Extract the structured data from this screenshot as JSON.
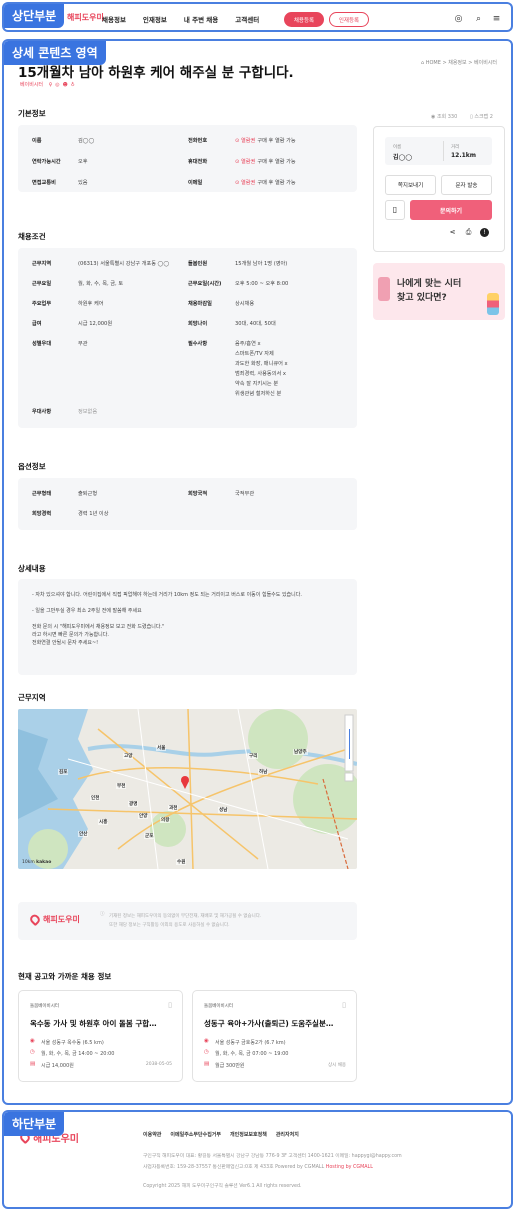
{
  "labels": {
    "top": "상단부분",
    "mid": "상세 콘텐츠 영역",
    "bot": "하단부분"
  },
  "header": {
    "logo": "해피도우미",
    "nav": [
      "채용정보",
      "인재정보",
      "내 주변 채용",
      "고객센터"
    ],
    "btn_job": "채용등록",
    "btn_talent": "인재등록"
  },
  "job": {
    "title": "15개월차 남아 하원후 케어 해주실 분 구합니다.",
    "category": "베이비시터",
    "breadcrumb": "HOME > 채용정보 > 베이비시터",
    "views": "조회 330",
    "scraps": "스크랩 2"
  },
  "basic": {
    "heading": "기본정보",
    "rows": [
      [
        "이름",
        "김◯◯",
        "전화번호",
        "열람권",
        "구매 후 열람 가능"
      ],
      [
        "연락가능시간",
        "오후",
        "휴대전화",
        "열람권",
        "구매 후 열람 가능"
      ],
      [
        "면접교통비",
        "있음",
        "이메일",
        "열람권",
        "구매 후 열람 가능"
      ]
    ]
  },
  "conditions": {
    "heading": "채용조건",
    "rows": [
      [
        "근무지역",
        "(06313) 서울특별시 강남구 개포동 ◯◯",
        "돌봄인원",
        "15개월 남아 1명 (영아)"
      ],
      [
        "근무요일",
        "월, 화, 수, 목, 금, 토",
        "근무요일(시간)",
        "오후 5:00 ~ 오후 8:00"
      ],
      [
        "주요업무",
        "하원후 케어",
        "채용마감일",
        "상시채용"
      ],
      [
        "급여",
        "시급 12,000원",
        "희망나이",
        "30대, 40대, 50대"
      ],
      [
        "성별우대",
        "무관",
        "필수사항",
        "음주/흡연 x"
      ]
    ],
    "required_extra": [
      "스마트폰/TV 자제",
      "과도한 화장, 매니큐어 x",
      "범죄경력, 사용동의서 x",
      "약속 잘 지키시는 분",
      "위생관념 철저하신 분"
    ],
    "pref_key": "우대사항",
    "pref_val": "정보없음"
  },
  "options": {
    "heading": "옵션정보",
    "rows": [
      [
        "근무형태",
        "출퇴근형",
        "희망국적",
        "국적무관"
      ],
      [
        "희망경력",
        "경력 1년 이상",
        "",
        ""
      ]
    ]
  },
  "detail": {
    "heading": "상세내용",
    "lines": [
      "- 자차 있으셔야 합니다. 어린이집에서 직접 픽업해야 하는데 거리가 10km 정도 되는 거리이고 버스로 이동이 힘들수도 있습니다.",
      "",
      "- 일을 그만두실 경우 최소 2주일 전에 말씀해 주세요",
      "",
      "전화 문의 시 \"해피도우미에서 채용정보 보고 전화 드렸습니다.\"",
      "라고 하시면 빠른 문의가 가능합니다.",
      "전화연결 안될시 문자 주세요~!"
    ]
  },
  "location": {
    "heading": "근무지역",
    "map_labels": [
      "서울",
      "인천",
      "부천",
      "광명",
      "과천",
      "안양",
      "성남",
      "하남",
      "구리",
      "안산",
      "시흥",
      "군포",
      "의왕",
      "수원",
      "고양",
      "김포",
      "남양주"
    ],
    "scale": "10km",
    "brand": "kakao"
  },
  "sidebar": {
    "name_label": "이름",
    "name": "김◯◯",
    "dist_label": "거리",
    "dist": "12.1km",
    "btn_msg": "쪽지보내기",
    "btn_sms": "문자 발송",
    "btn_inquiry": "문의하기",
    "banner_line1": "나에게 맞는 시터",
    "banner_line2": "찾고 있다면?"
  },
  "notice": {
    "logo": "해피도우미",
    "lines": [
      "기재된 정보는 해피도우미의 동의없이 무단전재, 재배포 및 재가공될 수 없습니다.",
      "또한 해당 정보는 구직활동 이외의 용도로 사용하실 수 없습니다."
    ]
  },
  "nearby": {
    "heading": "현재 공고와 가까운 채용 정보",
    "cards": [
      {
        "cat": "돌봄베이비시터",
        "title": "옥수동 가사 및 하원후 아이 돌봄 구합…",
        "loc": "서울 성동구 옥수동 (6.5 km)",
        "time": "월, 화, 수, 목, 금 14:00 ~ 20:00",
        "pay": "시급 14,000원",
        "extra": "2038-05-05"
      },
      {
        "cat": "돌봄베이비시터",
        "title": "성동구 육아+가사(출퇴근) 도움주실분…",
        "loc": "서울 성동구 금호동2가 (6.7 km)",
        "time": "월, 화, 수, 목, 금 07:00 ~ 19:00",
        "pay": "월급 300만원",
        "extra": "상시 채용"
      }
    ]
  },
  "footer": {
    "logo": "해피도우미",
    "links": [
      "이용약관",
      "이메일주소무단수집거부",
      "개인정보보호정책",
      "관리자처지"
    ],
    "info1": "구인구직 해피도우미    대표: 황길동    서울특별시 강남구 강남동 776-9 3F    고객센터 1400-1621    이메일: happygi@happy.com",
    "info2": "사업자등록번호: 159-28-37557    통신판매업신고:0호 제 433호    Powered by CGMALL",
    "info2_red": "Hosting by CGMALL",
    "copyright": "Copyright 2025 해피 도우미구인구직 솔루션 Ver6.1 All rights reserved."
  },
  "colors": {
    "accent": "#e8455b",
    "frame": "#4a7fe0"
  }
}
